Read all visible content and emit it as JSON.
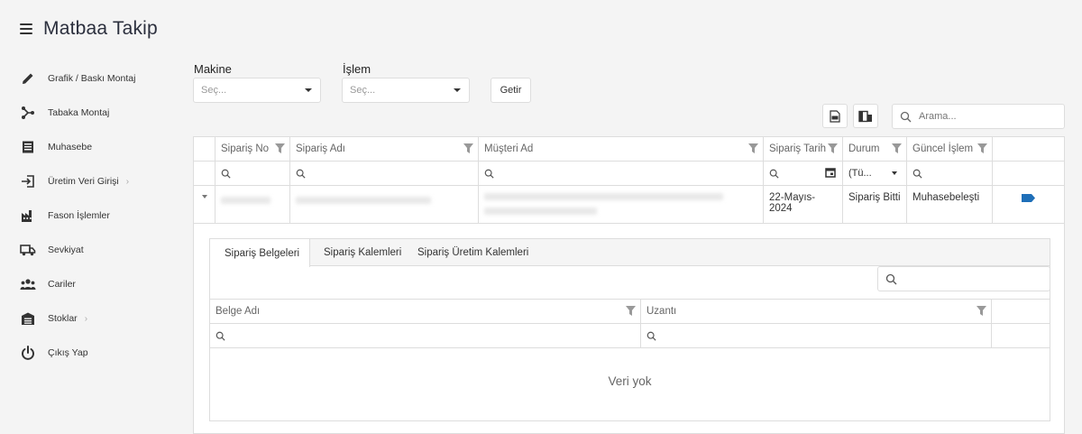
{
  "app": {
    "title": "Matbaa Takip"
  },
  "sidebar": {
    "items": [
      {
        "label": "Grafik / Baskı Montaj",
        "icon": "pencil-icon",
        "has_submenu": false
      },
      {
        "label": "Tabaka Montaj",
        "icon": "share-icon",
        "has_submenu": false
      },
      {
        "label": "Muhasebe",
        "icon": "document-icon",
        "has_submenu": false
      },
      {
        "label": "Üretim Veri Girişi",
        "icon": "login-icon",
        "has_submenu": true
      },
      {
        "label": "Fason İşlemler",
        "icon": "factory-icon",
        "has_submenu": false
      },
      {
        "label": "Sevkiyat",
        "icon": "truck-icon",
        "has_submenu": false
      },
      {
        "label": "Cariler",
        "icon": "group-icon",
        "has_submenu": false
      },
      {
        "label": "Stoklar",
        "icon": "warehouse-icon",
        "has_submenu": true
      },
      {
        "label": "Çıkış Yap",
        "icon": "power-icon",
        "has_submenu": false
      }
    ]
  },
  "filters": {
    "makine": {
      "label": "Makine",
      "placeholder": "Seç..."
    },
    "islem": {
      "label": "İşlem",
      "placeholder": "Seç..."
    },
    "getir_label": "Getir"
  },
  "toolbar": {
    "search_placeholder": "Arama..."
  },
  "grid": {
    "columns": [
      "Sipariş No",
      "Sipariş Adı",
      "Müşteri Ad",
      "Sipariş Tarih",
      "Durum",
      "Güncel İşlem"
    ],
    "durum_filter_value": "(Tü...",
    "row": {
      "siparis_tarih": "22-Mayıs-2024",
      "durum": "Sipariş Bitti",
      "guncel_islem": "Muhasebeleşti"
    }
  },
  "detail": {
    "tabs": [
      "Sipariş Belgeleri",
      "Sipariş Kalemleri",
      "Sipariş Üretim Kalemleri"
    ],
    "columns": [
      "Belge Adı",
      "Uzantı"
    ],
    "no_data": "Veri yok"
  },
  "colors": {
    "accent": "#1f6fb8",
    "border": "#dddddd",
    "background": "#f4f4f4"
  }
}
